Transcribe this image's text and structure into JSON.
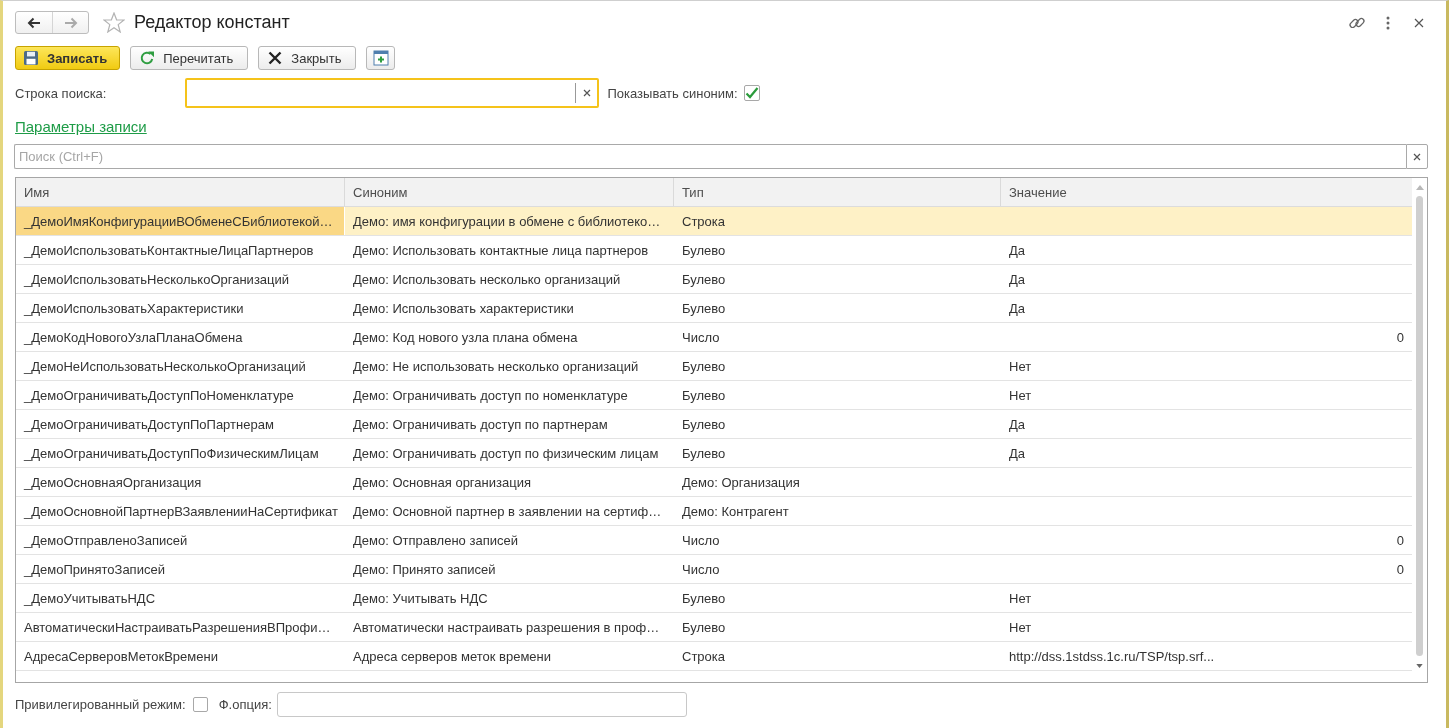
{
  "window": {
    "title": "Редактор констант",
    "favorite": false
  },
  "nav": [
    {
      "kind": "back",
      "disabled": false
    },
    {
      "kind": "forward",
      "disabled": true
    }
  ],
  "toolbar": [
    {
      "kind": "save",
      "label": "Записать",
      "default": true
    },
    {
      "kind": "reread",
      "label": "Перечитать",
      "default": false
    },
    {
      "kind": "close",
      "label": "Закрыть",
      "default": false
    },
    {
      "kind": "add",
      "default": false
    }
  ],
  "search_string": {
    "label": "Строка поиска:",
    "focused": true
  },
  "show_synonym": {
    "label": "Показывать синоним:",
    "checked": true
  },
  "record_settings_link": "Параметры записи",
  "find": {
    "placeholder": "Поиск (Ctrl+F)",
    "focused": false
  },
  "table": {
    "columns": [
      "Имя",
      "Синоним",
      "Тип",
      "Значение"
    ],
    "rows": [
      {
        "name": "_ДемоИмяКонфигурацииВОбменеСБиблиотекой…",
        "synonym": "Демо: имя конфигурации в обмене с библиотеко…",
        "type": "Строка",
        "kind": "text",
        "selected": true
      },
      {
        "name": "_ДемоИспользоватьКонтактныеЛицаПартнеров",
        "synonym": "Демо: Использовать контактные лица партнеров",
        "type": "Булево",
        "value": "Да",
        "kind": "text",
        "selected": false
      },
      {
        "name": "_ДемоИспользоватьНесколькоОрганизаций",
        "synonym": "Демо: Использовать несколько организаций",
        "type": "Булево",
        "value": "Да",
        "kind": "text",
        "selected": false
      },
      {
        "name": "_ДемоИспользоватьХарактеристики",
        "synonym": "Демо: Использовать характеристики",
        "type": "Булево",
        "value": "Да",
        "kind": "text",
        "selected": false
      },
      {
        "name": "_ДемоКодНовогоУзлаПланаОбмена",
        "synonym": "Демо: Код нового узла плана обмена",
        "type": "Число",
        "value": "0",
        "kind": "number",
        "selected": false
      },
      {
        "name": "_ДемоНеИспользоватьНесколькоОрганизаций",
        "synonym": "Демо: Не использовать несколько организаций",
        "type": "Булево",
        "value": "Нет",
        "kind": "text",
        "selected": false
      },
      {
        "name": "_ДемоОграничиватьДоступПоНоменклатуре",
        "synonym": "Демо: Ограничивать доступ по номенклатуре",
        "type": "Булево",
        "value": "Нет",
        "kind": "text",
        "selected": false
      },
      {
        "name": "_ДемоОграничиватьДоступПоПартнерам",
        "synonym": "Демо: Ограничивать доступ по партнерам",
        "type": "Булево",
        "value": "Да",
        "kind": "text",
        "selected": false
      },
      {
        "name": "_ДемоОграничиватьДоступПоФизическимЛицам",
        "synonym": "Демо: Ограничивать доступ по физическим лицам",
        "type": "Булево",
        "value": "Да",
        "kind": "text",
        "selected": false
      },
      {
        "name": "_ДемоОсновнаяОрганизация",
        "synonym": "Демо: Основная организация",
        "type": "Демо: Организация",
        "kind": "text",
        "selected": false
      },
      {
        "name": "_ДемоОсновнойПартнерВЗаявленииНаСертификат",
        "synonym": "Демо: Основной партнер в заявлении на сертиф…",
        "type": "Демо: Контрагент",
        "kind": "text",
        "selected": false
      },
      {
        "name": "_ДемоОтправленоЗаписей",
        "synonym": "Демо: Отправлено записей",
        "type": "Число",
        "value": "0",
        "kind": "number",
        "selected": false
      },
      {
        "name": "_ДемоПринятоЗаписей",
        "synonym": "Демо: Принято записей",
        "type": "Число",
        "value": "0",
        "kind": "number",
        "selected": false
      },
      {
        "name": "_ДемоУчитыватьНДС",
        "synonym": "Демо: Учитывать НДС",
        "type": "Булево",
        "value": "Нет",
        "kind": "text",
        "selected": false
      },
      {
        "name": "АвтоматическиНастраиватьРазрешенияВПрофи…",
        "synonym": "Автоматически настраивать разрешения в проф…",
        "type": "Булево",
        "value": "Нет",
        "kind": "text",
        "selected": false
      },
      {
        "name": "АдресаСерверовМетокВремени",
        "synonym": "Адреса серверов меток времени",
        "type": "Строка",
        "value": "http://dss.1stdss.1c.ru/TSP/tsp.srf...",
        "kind": "text",
        "selected": false
      }
    ]
  },
  "privileged_mode": {
    "label": "Привилегированный режим:",
    "checked": false
  },
  "functional_option": {
    "label": "Ф.опция:"
  }
}
